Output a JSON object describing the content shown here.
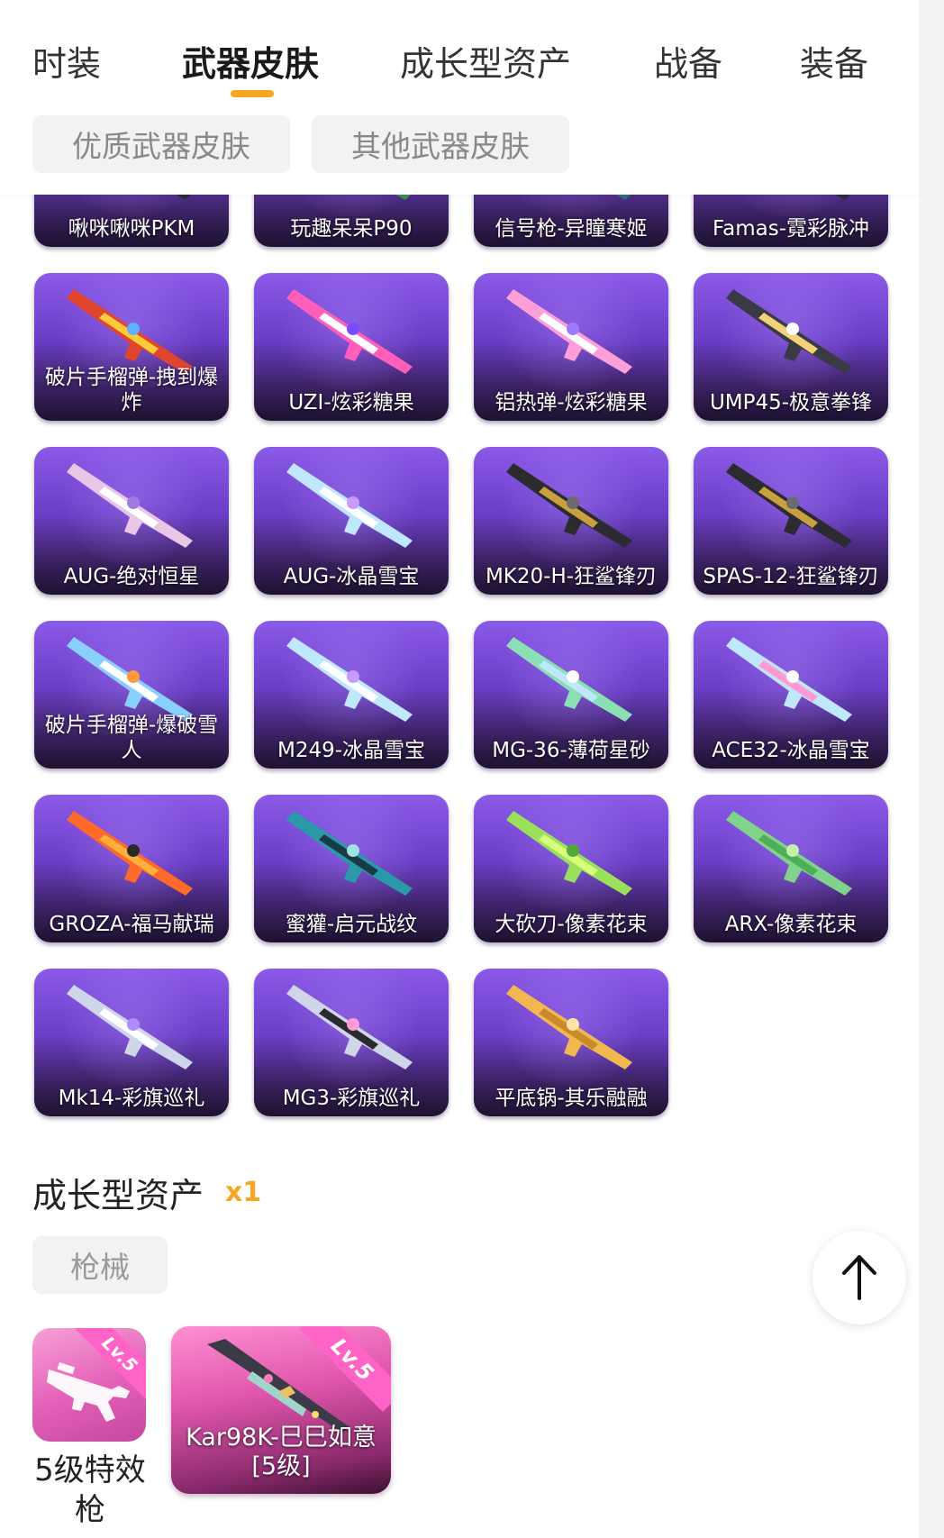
{
  "tabs": [
    {
      "label": "时装"
    },
    {
      "label": "武器皮肤",
      "active": true
    },
    {
      "label": "成长型资产"
    },
    {
      "label": "战备"
    },
    {
      "label": "装备"
    }
  ],
  "subtabs": [
    {
      "label": "优质武器皮肤"
    },
    {
      "label": "其他武器皮肤"
    }
  ],
  "weapon_skins": [
    {
      "name": "啾咪啾咪PKM"
    },
    {
      "name": "玩趣呆呆P90"
    },
    {
      "name": "信号枪-异瞳寒姬"
    },
    {
      "name": "Famas-霓彩脉冲"
    },
    {
      "name": "破片手榴弹-拽到爆炸"
    },
    {
      "name": "UZI-炫彩糖果"
    },
    {
      "name": "铝热弹-炫彩糖果"
    },
    {
      "name": "UMP45-极意拳锋"
    },
    {
      "name": "AUG-绝对恒星"
    },
    {
      "name": "AUG-冰晶雪宝"
    },
    {
      "name": "MK20-H-狂鲨锋刃"
    },
    {
      "name": "SPAS-12-狂鲨锋刃"
    },
    {
      "name": "破片手榴弹-爆破雪人"
    },
    {
      "name": "M249-冰晶雪宝"
    },
    {
      "name": "MG-36-薄荷星砂"
    },
    {
      "name": "ACE32-冰晶雪宝"
    },
    {
      "name": "GROZA-福马献瑞"
    },
    {
      "name": "蜜獾-启元战纹"
    },
    {
      "name": "大砍刀-像素花束"
    },
    {
      "name": "ARX-像素花束"
    },
    {
      "name": "Mk14-彩旗巡礼"
    },
    {
      "name": "MG3-彩旗巡礼"
    },
    {
      "name": "平底锅-其乐融融"
    }
  ],
  "growth_section": {
    "title": "成长型资产",
    "count": "x1",
    "filter": "枪械",
    "items": [
      {
        "caption": "5级特效枪",
        "level": "Lv.5"
      },
      {
        "name": "Kar98K-巳巳如意[5级]",
        "level": "Lv.5"
      }
    ]
  },
  "colors": {
    "accent": "#f5a623",
    "card_purple": "#6b3ec7",
    "asset_pink": "#e35fb8"
  },
  "icons": {
    "scroll_top": "arrow-up-icon"
  }
}
